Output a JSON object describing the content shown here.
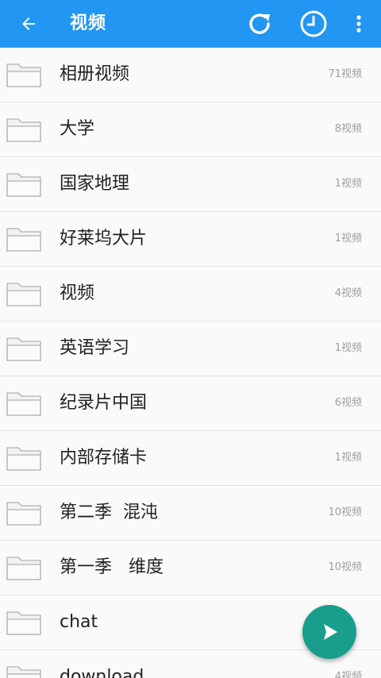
{
  "header": {
    "title": "视频",
    "back_icon": "arrow-left-icon",
    "actions": [
      "refresh-icon",
      "history-clock-icon",
      "more-vert-icon"
    ],
    "background": "#2196f3"
  },
  "folders": [
    {
      "name": "相册视频",
      "count": "71视频"
    },
    {
      "name": "大学",
      "count": "8视频"
    },
    {
      "name": "国家地理",
      "count": "1视频"
    },
    {
      "name": "好莱坞大片",
      "count": "1视频"
    },
    {
      "name": "视频",
      "count": "4视频"
    },
    {
      "name": "英语学习",
      "count": "1视频"
    },
    {
      "name": "纪录片中国",
      "count": "6视频"
    },
    {
      "name": "内部存储卡",
      "count": "1视频"
    },
    {
      "name": "第二季  混沌",
      "count": "10视频"
    },
    {
      "name": "第一季   维度",
      "count": "10视频"
    },
    {
      "name": "chat",
      "count": ""
    },
    {
      "name": "download",
      "count": "4视频"
    }
  ],
  "fab": {
    "icon": "play-icon",
    "color": "#1a9e8c"
  }
}
